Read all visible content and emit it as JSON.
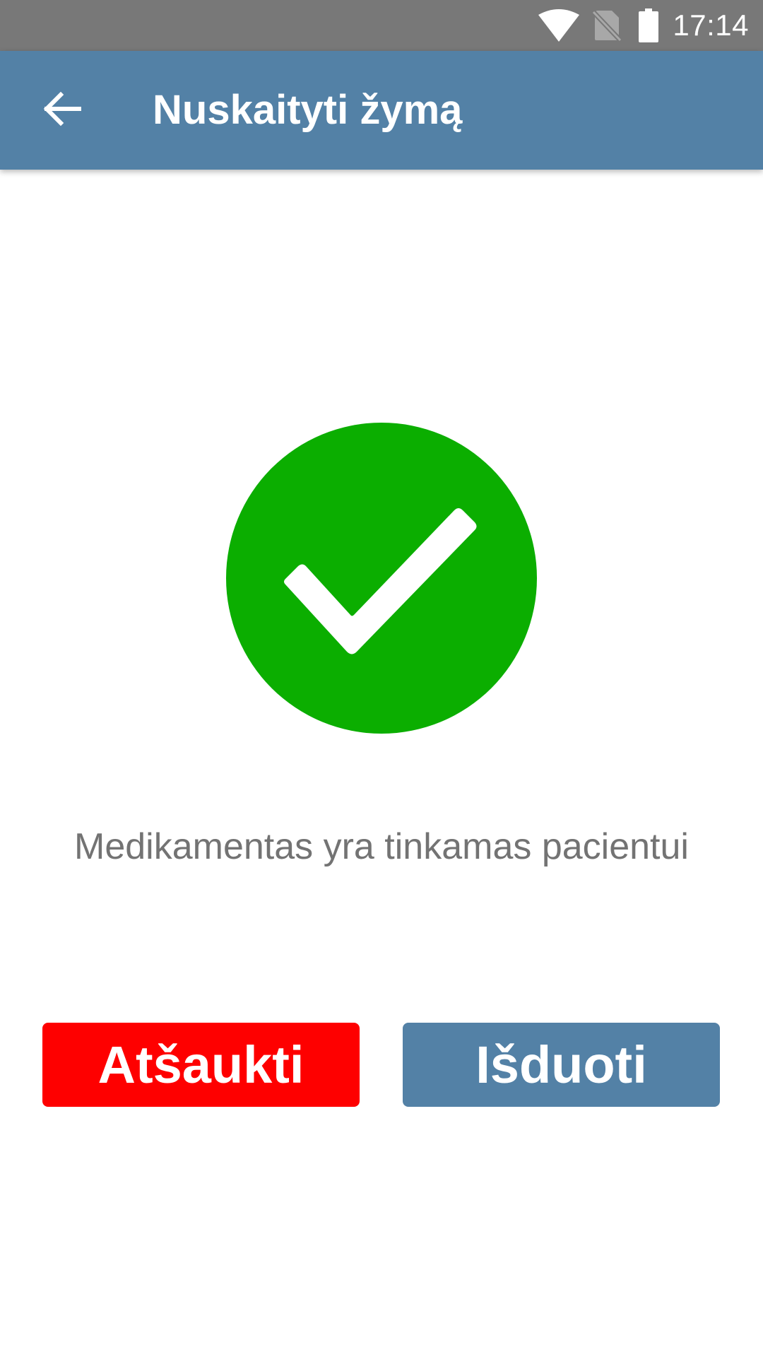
{
  "status_bar": {
    "time": "17:14",
    "icons": [
      "wifi-icon",
      "no-sim-icon",
      "battery-icon"
    ]
  },
  "app_bar": {
    "back_icon": "arrow-back-icon",
    "title": "Nuskaityti žymą"
  },
  "result": {
    "icon": "check-circle-icon",
    "message": "Medikamentas yra tinkamas pacientui"
  },
  "actions": {
    "cancel_label": "Atšaukti",
    "issue_label": "Išduoti"
  },
  "colors": {
    "status_bar": "#787878",
    "app_bar": "#5381a6",
    "success": "#0bae00",
    "cancel": "#fe0000",
    "issue": "#5381a6",
    "message_text": "#737373"
  }
}
